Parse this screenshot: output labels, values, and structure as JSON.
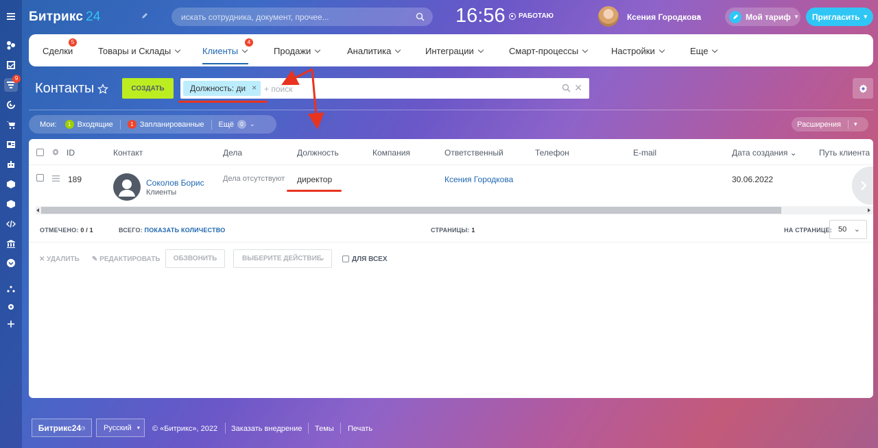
{
  "app": {
    "logo_text": "Битрикс",
    "logo_num": "24",
    "search_placeholder": "искать сотрудника, документ, прочее...",
    "clock": "16:56",
    "status": "РАБОТАЮ",
    "user_name": "Ксения Городкова",
    "tariff": "Мой тариф",
    "invite": "Пригласить"
  },
  "rail": {
    "badge": "9"
  },
  "menu": {
    "items": [
      {
        "label": "Сделки",
        "badge": "5"
      },
      {
        "label": "Товары и Склады"
      },
      {
        "label": "Клиенты",
        "badge": "4"
      },
      {
        "label": "Продажи"
      },
      {
        "label": "Аналитика"
      },
      {
        "label": "Интеграции"
      },
      {
        "label": "Смарт-процессы"
      },
      {
        "label": "Настройки"
      },
      {
        "label": "Еще"
      }
    ]
  },
  "page": {
    "title": "Контакты",
    "create": "СОЗДАТЬ",
    "filter_chip": "Должность: ди",
    "filter_placeholder": "+ поиск"
  },
  "counters": {
    "my": "Мои:",
    "incoming_count": "1",
    "incoming": "Входящие",
    "planned_count": "1",
    "planned": "Запланированные",
    "more": "Ещё",
    "more_count": "0",
    "extensions": "Расширения"
  },
  "colors": {
    "accent": "#2fc6f6",
    "create_button": "#bbed21",
    "link": "#2067b0",
    "badge": "#f0442c",
    "annotation": "#e8331f",
    "incoming_counter": "#9dcf00",
    "planned_counter": "#f0442c"
  },
  "grid": {
    "columns": [
      "ID",
      "Контакт",
      "Дела",
      "Должность",
      "Компания",
      "Ответственный",
      "Телефон",
      "E-mail",
      "Дата создания",
      "Путь клиента"
    ],
    "rows": [
      {
        "id": "189",
        "contact_name": "Соколов Борис",
        "contact_type": "Клиенты",
        "activities": "Дела отсутствуют",
        "position": "директор",
        "company": "",
        "responsible": "Ксения Городкова",
        "phone": "",
        "email": "",
        "created": "30.06.2022"
      }
    ]
  },
  "footer_stats": {
    "selected_label": "ОТМЕЧЕНО:",
    "selected_value": "0 / 1",
    "total_label": "ВСЕГО:",
    "total_link": "ПОКАЗАТЬ КОЛИЧЕСТВО",
    "pages_label": "СТРАНИЦЫ:",
    "pages_value": "1",
    "per_page_label": "НА СТРАНИЦЕ:",
    "per_page_value": "50"
  },
  "actions": {
    "delete": "УДАЛИТЬ",
    "edit": "РЕДАКТИРОВАТЬ",
    "call": "ОБЗВОНИТЬ",
    "choose": "ВЫБЕРИТЕ ДЕЙСТВИЕ",
    "for_all": "ДЛЯ ВСЕХ"
  },
  "footer": {
    "logo": "Битрикс24",
    "lang": "Русский",
    "copyright": "© «Битрикс», 2022",
    "order": "Заказать внедрение",
    "themes": "Темы",
    "print": "Печать"
  }
}
